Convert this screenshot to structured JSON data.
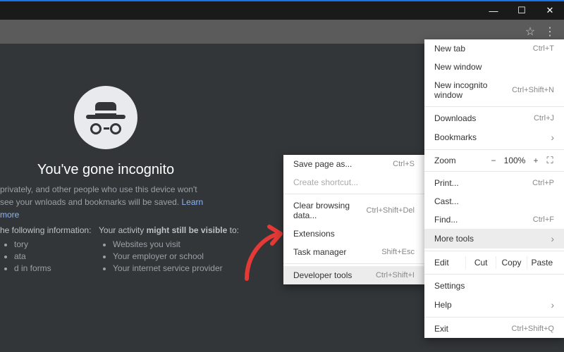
{
  "window": {
    "minimize": "—",
    "maximize": "☐",
    "close": "✕"
  },
  "toolbar": {
    "star": "☆",
    "kebab": "⋮"
  },
  "page": {
    "heading": "You've gone incognito",
    "body_prefix": " privately, and other people who use this device won't see your wnloads and bookmarks will be saved. ",
    "learn_more": "Learn more",
    "left_head": "he following information:",
    "left_items": [
      "tory",
      "ata",
      "d in forms"
    ],
    "right_head_a": "Your activity ",
    "right_head_b": "might still be visible",
    "right_head_c": " to:",
    "right_items": [
      "Websites you visit",
      "Your employer or school",
      "Your internet service provider"
    ]
  },
  "menu": {
    "new_tab": "New tab",
    "new_tab_sc": "Ctrl+T",
    "new_window": "New window",
    "new_incog": "New incognito window",
    "new_incog_sc": "Ctrl+Shift+N",
    "downloads": "Downloads",
    "downloads_sc": "Ctrl+J",
    "bookmarks": "Bookmarks",
    "zoom": "Zoom",
    "zoom_val": "100%",
    "print": "Print...",
    "print_sc": "Ctrl+P",
    "cast": "Cast...",
    "find": "Find...",
    "find_sc": "Ctrl+F",
    "more_tools": "More tools",
    "edit": "Edit",
    "cut": "Cut",
    "copy": "Copy",
    "paste": "Paste",
    "settings": "Settings",
    "help": "Help",
    "exit": "Exit",
    "exit_sc": "Ctrl+Shift+Q"
  },
  "submenu": {
    "save_as": "Save page as...",
    "save_as_sc": "Ctrl+S",
    "create_shortcut": "Create shortcut...",
    "clear_data": "Clear browsing data...",
    "clear_data_sc": "Ctrl+Shift+Del",
    "extensions": "Extensions",
    "task_mgr": "Task manager",
    "task_mgr_sc": "Shift+Esc",
    "dev_tools": "Developer tools",
    "dev_tools_sc": "Ctrl+Shift+I"
  }
}
